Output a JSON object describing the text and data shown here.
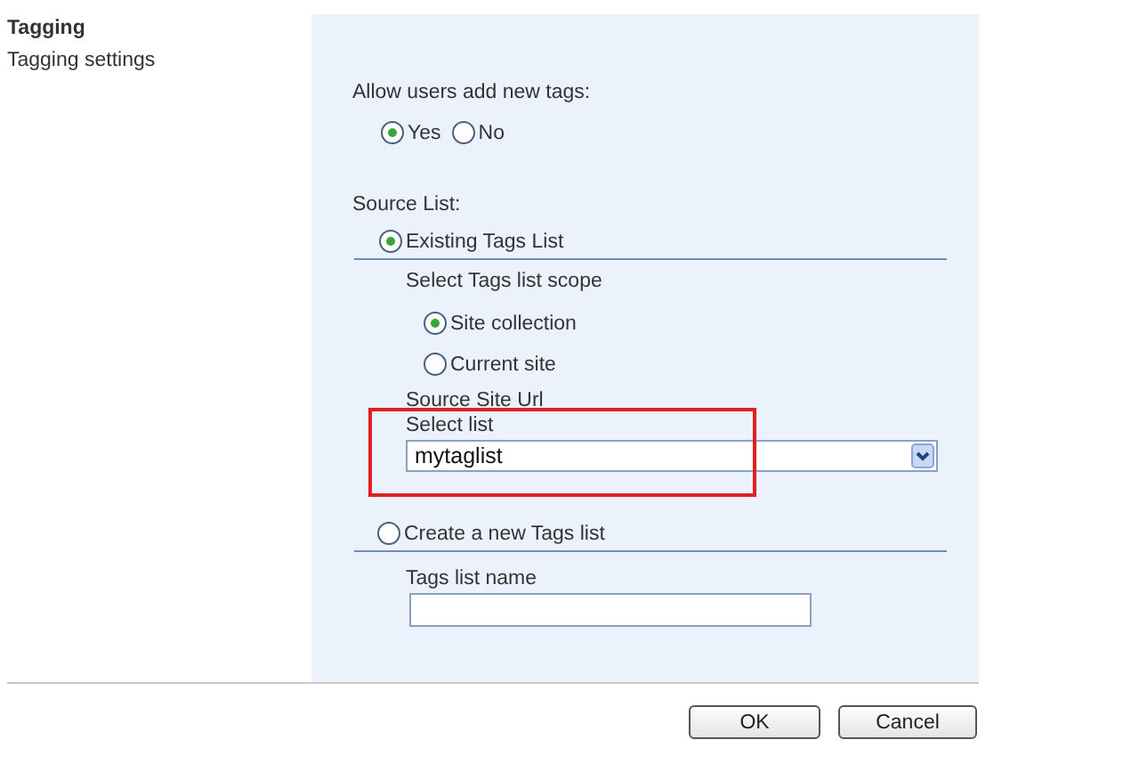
{
  "section": {
    "title": "Tagging",
    "description": "Tagging settings"
  },
  "allow_new_tags": {
    "label": "Allow users add new tags:",
    "options": [
      {
        "label": "Yes",
        "selected": true
      },
      {
        "label": "No",
        "selected": false
      }
    ]
  },
  "source_list": {
    "label": "Source List:",
    "options": [
      {
        "label": "Existing Tags List",
        "selected": true
      },
      {
        "label": "Create a new Tags list",
        "selected": false
      }
    ]
  },
  "scope": {
    "label": "Select Tags list scope",
    "options": [
      {
        "label": "Site collection",
        "selected": true
      },
      {
        "label": "Current site",
        "selected": false
      }
    ]
  },
  "source_site_url": {
    "label": "Source Site Url"
  },
  "select_list": {
    "label": "Select list",
    "value": "mytaglist"
  },
  "tags_list_name": {
    "label": "Tags list name"
  },
  "buttons": [
    "OK",
    "Cancel"
  ]
}
